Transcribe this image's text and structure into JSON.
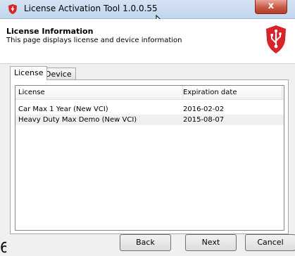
{
  "window": {
    "title": "License Activation Tool 1.0.0.55",
    "close_label": "x"
  },
  "header": {
    "title": "License Information",
    "subtitle": "This page displays license and device information"
  },
  "tabs": [
    {
      "label": "License",
      "active": true
    },
    {
      "label": "Device",
      "active": false
    }
  ],
  "license_table": {
    "columns": [
      "License",
      "Expiration date"
    ],
    "rows": [
      {
        "license": "Car Max 1 Year (New VCI)",
        "expiration": "2016-02-02"
      },
      {
        "license": "Heavy Duty Max Demo (New VCI)",
        "expiration": "2015-08-07"
      }
    ]
  },
  "buttons": {
    "back": "Back",
    "next": "Next",
    "cancel": "Cancel"
  },
  "edge_text": "6",
  "colors": {
    "brand_red": "#d8232a",
    "close_button": "#c75a48",
    "selected_row": "#f0f0f0"
  },
  "icons": {
    "app": "shield-usb-icon",
    "logo": "shield-usb-logo",
    "cursor": "mouse-cursor-icon"
  }
}
